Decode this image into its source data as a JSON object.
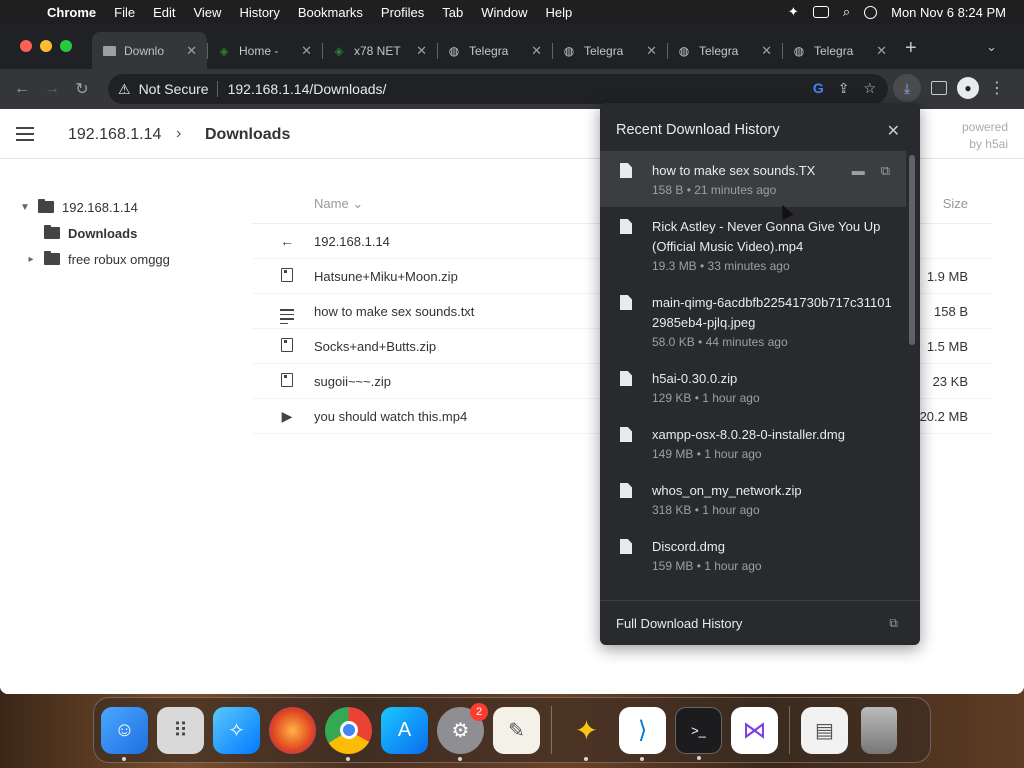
{
  "menubar": {
    "app": "Chrome",
    "items": [
      "File",
      "Edit",
      "View",
      "History",
      "Bookmarks",
      "Profiles",
      "Tab",
      "Window",
      "Help"
    ],
    "clock": "Mon Nov 6  8:24 PM"
  },
  "tabs": [
    {
      "title": "Downlo",
      "icon": "folder-icon",
      "active": true
    },
    {
      "title": "Home -",
      "icon": "xnet-icon"
    },
    {
      "title": "x78 NET",
      "icon": "xnet-icon"
    },
    {
      "title": "Telegra",
      "icon": "globe-icon"
    },
    {
      "title": "Telegra",
      "icon": "globe-icon"
    },
    {
      "title": "Telegra",
      "icon": "globe-icon"
    },
    {
      "title": "Telegra",
      "icon": "globe-icon"
    }
  ],
  "omnibox": {
    "security": "Not Secure",
    "host": "192.168.1.14",
    "path": "/Downloads/"
  },
  "page": {
    "breadcrumb_root": "192.168.1.14",
    "breadcrumb_current": "Downloads",
    "powered_line1": "powered",
    "powered_line2": "by h5ai",
    "tree": {
      "root": "192.168.1.14",
      "children": [
        "Downloads",
        "free robux omggg"
      ]
    },
    "list_header": {
      "name": "Name",
      "size": "Size"
    },
    "parent_row": "192.168.1.14",
    "files": [
      {
        "name": "Hatsune+Miku+Moon.zip",
        "size": "1.9 MB",
        "type": "zip"
      },
      {
        "name": "how to make sex sounds.txt",
        "size": "158 B",
        "type": "txt"
      },
      {
        "name": "Socks+and+Butts.zip",
        "size": "1.5 MB",
        "type": "zip"
      },
      {
        "name": "sugoii~~~.zip",
        "size": "23 KB",
        "type": "zip"
      },
      {
        "name": "you should watch this.mp4",
        "size": "20.2 MB",
        "type": "video"
      }
    ]
  },
  "downloads": {
    "title": "Recent Download History",
    "items": [
      {
        "name": "how to make sex sounds.TX",
        "meta": "158 B • 21 minutes ago"
      },
      {
        "name": "Rick Astley - Never Gonna Give You Up (Official Music Video).mp4",
        "meta": "19.3 MB • 33 minutes ago"
      },
      {
        "name": "main-qimg-6acdbfb22541730b717c311012985eb4-pjlq.jpeg",
        "meta": "58.0 KB • 44 minutes ago"
      },
      {
        "name": "h5ai-0.30.0.zip",
        "meta": "129 KB • 1 hour ago"
      },
      {
        "name": "xampp-osx-8.0.28-0-installer.dmg",
        "meta": "149 MB • 1 hour ago"
      },
      {
        "name": "whos_on_my_network.zip",
        "meta": "318 KB • 1 hour ago"
      },
      {
        "name": "Discord.dmg",
        "meta": "159 MB • 1 hour ago"
      }
    ],
    "footer": "Full Download History"
  },
  "dock": {
    "settings_badge": "2"
  },
  "colors": {
    "chrome_dark": "#202124",
    "toolbar": "#35363a",
    "bubble": "#292a2d"
  }
}
